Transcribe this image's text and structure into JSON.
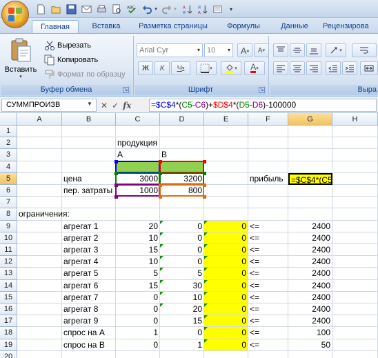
{
  "quick_access": [
    "save-icon",
    "new-icon",
    "open-icon",
    "print-icon",
    "preview-icon",
    "spell-icon",
    "undo-icon",
    "redo-icon",
    "sort-asc-icon",
    "sort-desc-icon",
    "customize-icon"
  ],
  "tabs": [
    "Главная",
    "Вставка",
    "Разметка страницы",
    "Формулы",
    "Данные",
    "Рецензирова"
  ],
  "clipboard": {
    "paste": "Вставить",
    "cut": "Вырезать",
    "copy": "Копировать",
    "format_painter": "Формат по образцу",
    "group": "Буфер обмена"
  },
  "font": {
    "name": "Arial Cyr",
    "size": "10",
    "bold": "Ж",
    "italic": "К",
    "underline": "Ч",
    "grow": "A",
    "shrink": "A",
    "color_letter": "A",
    "group": "Шрифт"
  },
  "align_group": "Выра",
  "formula_bar": {
    "name_box": "СУММПРОИЗВ",
    "fx": "fx",
    "parts": [
      "=",
      "$C$4",
      "*(",
      "C5",
      "-",
      "C6",
      ")+",
      "$D$4",
      "*(",
      "D5",
      "-",
      "D6",
      ")-100000"
    ]
  },
  "columns": [
    "A",
    "B",
    "C",
    "D",
    "E",
    "F",
    "G",
    "H"
  ],
  "rows": [
    "1",
    "2",
    "3",
    "4",
    "5",
    "6",
    "7",
    "8",
    "9",
    "10",
    "11",
    "12",
    "13",
    "14",
    "15",
    "16",
    "17",
    "18",
    "19",
    "20"
  ],
  "cells": {
    "C2": "продукция",
    "C3": "A",
    "D3": "B",
    "B5": "цена",
    "C5": "3000",
    "D5": "3200",
    "F5": "прибыль",
    "G5": "=$C$4*(C5",
    "B6": "пер. затраты",
    "C6": "1000",
    "D6": "800",
    "A8": "ограничения:",
    "table": [
      {
        "b": "агрегат 1",
        "c": "20",
        "d": "0",
        "e": "0",
        "f": "<=",
        "g": "2400"
      },
      {
        "b": "агрегат 2",
        "c": "10",
        "d": "0",
        "e": "0",
        "f": "<=",
        "g": "2400"
      },
      {
        "b": "агрегат 3",
        "c": "15",
        "d": "0",
        "e": "0",
        "f": "<=",
        "g": "2400"
      },
      {
        "b": "агрегат 4",
        "c": "10",
        "d": "0",
        "e": "0",
        "f": "<=",
        "g": "2400"
      },
      {
        "b": "агрегат 5",
        "c": "5",
        "d": "5",
        "e": "0",
        "f": "<=",
        "g": "2400"
      },
      {
        "b": "агрегат 6",
        "c": "15",
        "d": "30",
        "e": "0",
        "f": "<=",
        "g": "2400"
      },
      {
        "b": "агрегат 7",
        "c": "0",
        "d": "10",
        "e": "0",
        "f": "<=",
        "g": "2400"
      },
      {
        "b": "агрегат 8",
        "c": "0",
        "d": "20",
        "e": "0",
        "f": "<=",
        "g": "2400"
      },
      {
        "b": "агрегат 9",
        "c": "0",
        "d": "15",
        "e": "0",
        "f": "<=",
        "g": "2400"
      },
      {
        "b": "спрос на A",
        "c": "1",
        "d": "0",
        "e": "0",
        "f": "<=",
        "g": "100"
      },
      {
        "b": "спрос на B",
        "c": "0",
        "d": "1",
        "e": "0",
        "f": "<=",
        "g": "50"
      }
    ]
  },
  "colors": {
    "yellow_fill": "#ffff00",
    "green_fill": "#92d050",
    "ref_blue": "#0000ff",
    "ref_green": "#008000",
    "ref_purple": "#800080",
    "ref_red": "#ff0000",
    "ribbon_text": "#15428b"
  }
}
